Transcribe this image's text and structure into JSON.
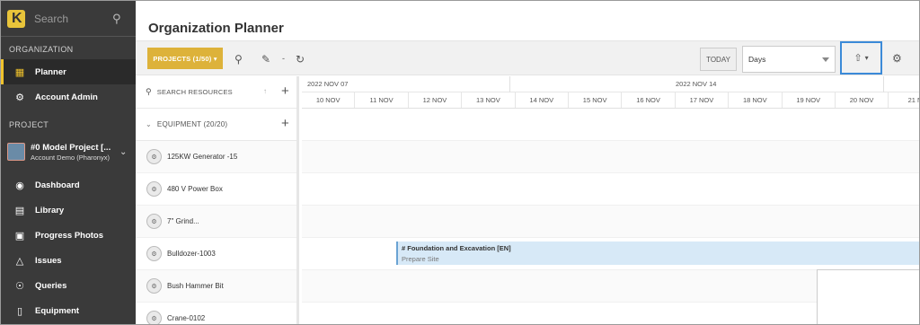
{
  "app": {
    "logo_letter": "K",
    "search_placeholder": "Search"
  },
  "sidebar": {
    "org_section": "ORGANIZATION",
    "org_items": [
      {
        "label": "Planner",
        "icon": "calendar-icon",
        "active": true
      },
      {
        "label": "Account Admin",
        "icon": "gears-icon",
        "active": false
      }
    ],
    "project_section": "PROJECT",
    "project": {
      "name": "#0 Model Project [...",
      "sub": "Account Demo (Pharonyx)"
    },
    "project_items": [
      {
        "label": "Dashboard",
        "icon": "dashboard-icon"
      },
      {
        "label": "Library",
        "icon": "library-icon"
      },
      {
        "label": "Progress Photos",
        "icon": "photos-icon"
      },
      {
        "label": "Issues",
        "icon": "warning-icon"
      },
      {
        "label": "Queries",
        "icon": "location-pin-icon"
      },
      {
        "label": "Equipment",
        "icon": "barcode-icon"
      }
    ]
  },
  "main": {
    "title": "Organization Planner",
    "toolbar": {
      "projects_label": "PROJECTS (1/50)",
      "dash": "-",
      "today_label": "TODAY",
      "view_select": "Days"
    },
    "resources": {
      "search_label": "SEARCH RESOURCES",
      "group_label": "EQUIPMENT (20/20)",
      "items": [
        "125KW Generator -15",
        "480 V Power Box",
        "7\" Grind...",
        "Bulldozer-1003",
        "Bush Hammer Bit",
        "Crane-0102"
      ]
    },
    "calendar": {
      "weeks": [
        "2022 NOV 07",
        "2022 NOV 14"
      ],
      "days": [
        "10 NOV",
        "11 NOV",
        "12 NOV",
        "13 NOV",
        "14 NOV",
        "15 NOV",
        "16 NOV",
        "17 NOV",
        "18 NOV",
        "19 NOV",
        "20 NOV",
        "21 N"
      ],
      "task": {
        "title": "# Foundation and Excavation [EN]",
        "subtitle": "Prepare Site"
      }
    }
  },
  "colors": {
    "accent": "#ddb23a",
    "sidebar_bg": "#3a3a3a",
    "highlight": "#3b8ad8",
    "task_bar": "#d7e9f7"
  }
}
